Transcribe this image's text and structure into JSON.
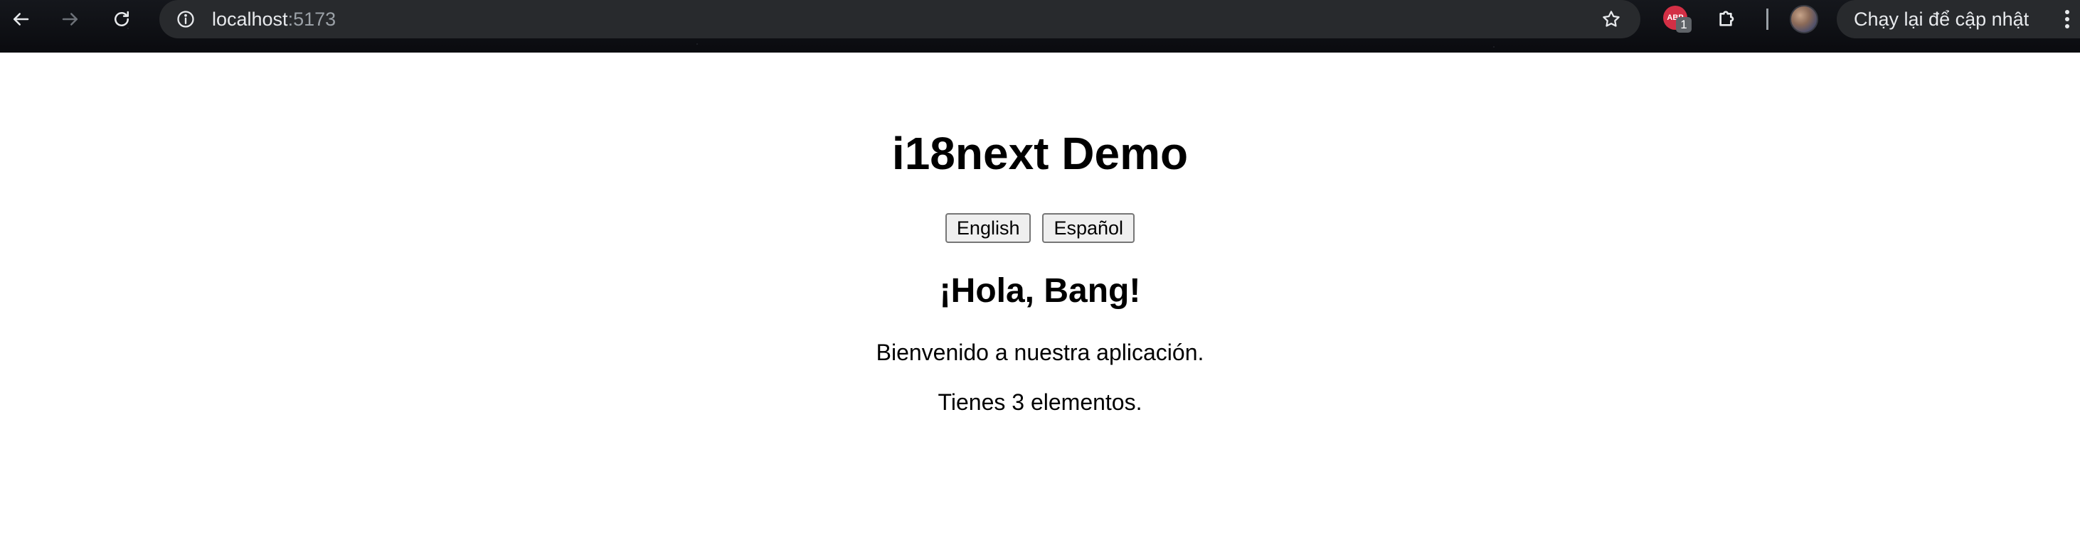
{
  "browser": {
    "url_host": "localhost",
    "url_port": ":5173",
    "adblock_badge": "1",
    "update_button_label": "Chạy lại để cập nhật",
    "icons": {
      "back": "arrow-left-icon",
      "forward": "arrow-right-icon",
      "reload": "reload-icon",
      "site_info": "info-icon",
      "bookmark": "star-icon",
      "extensions": "puzzle-icon",
      "menu": "kebab-menu-icon"
    }
  },
  "page": {
    "title": "i18next Demo",
    "buttons": {
      "english": "English",
      "spanish": "Español"
    },
    "greeting": "¡Hola, Bang!",
    "welcome": "Bienvenido a nuestra aplicación.",
    "items_message": "Tienes 3 elementos."
  }
}
